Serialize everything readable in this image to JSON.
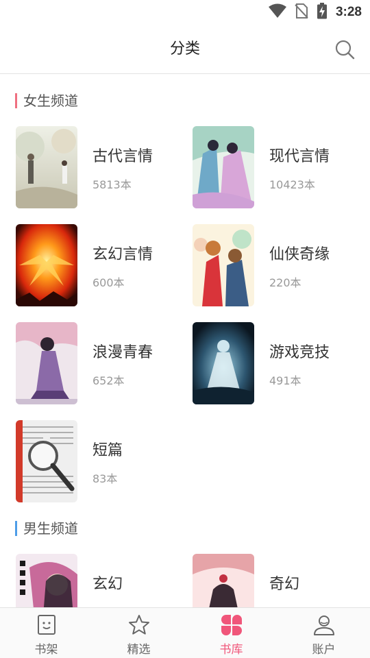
{
  "status_bar": {
    "time": "3:28",
    "icons": [
      "wifi-icon",
      "no-sim-icon",
      "battery-charging-icon"
    ]
  },
  "header": {
    "title": "分类",
    "search_icon": "search-icon"
  },
  "sections": [
    {
      "label": "女生频道",
      "accent_color": "#ef6f80",
      "categories": [
        {
          "name": "古代言情",
          "count": "5813本"
        },
        {
          "name": "现代言情",
          "count": "10423本"
        },
        {
          "name": "玄幻言情",
          "count": "600本"
        },
        {
          "name": "仙侠奇缘",
          "count": "220本"
        },
        {
          "name": "浪漫青春",
          "count": "652本"
        },
        {
          "name": "游戏竞技",
          "count": "491本"
        },
        {
          "name": "短篇",
          "count": "83本"
        }
      ]
    },
    {
      "label": "男生频道",
      "accent_color": "#4d9de8",
      "categories": [
        {
          "name": "玄幻",
          "count": ""
        },
        {
          "name": "奇幻",
          "count": ""
        }
      ]
    }
  ],
  "tab_bar": {
    "active_color": "#f0567a",
    "tabs": [
      {
        "label": "书架",
        "icon": "bookshelf-icon",
        "active": false
      },
      {
        "label": "精选",
        "icon": "star-icon",
        "active": false
      },
      {
        "label": "书库",
        "icon": "library-icon",
        "active": true
      },
      {
        "label": "账户",
        "icon": "account-icon",
        "active": false
      }
    ]
  }
}
